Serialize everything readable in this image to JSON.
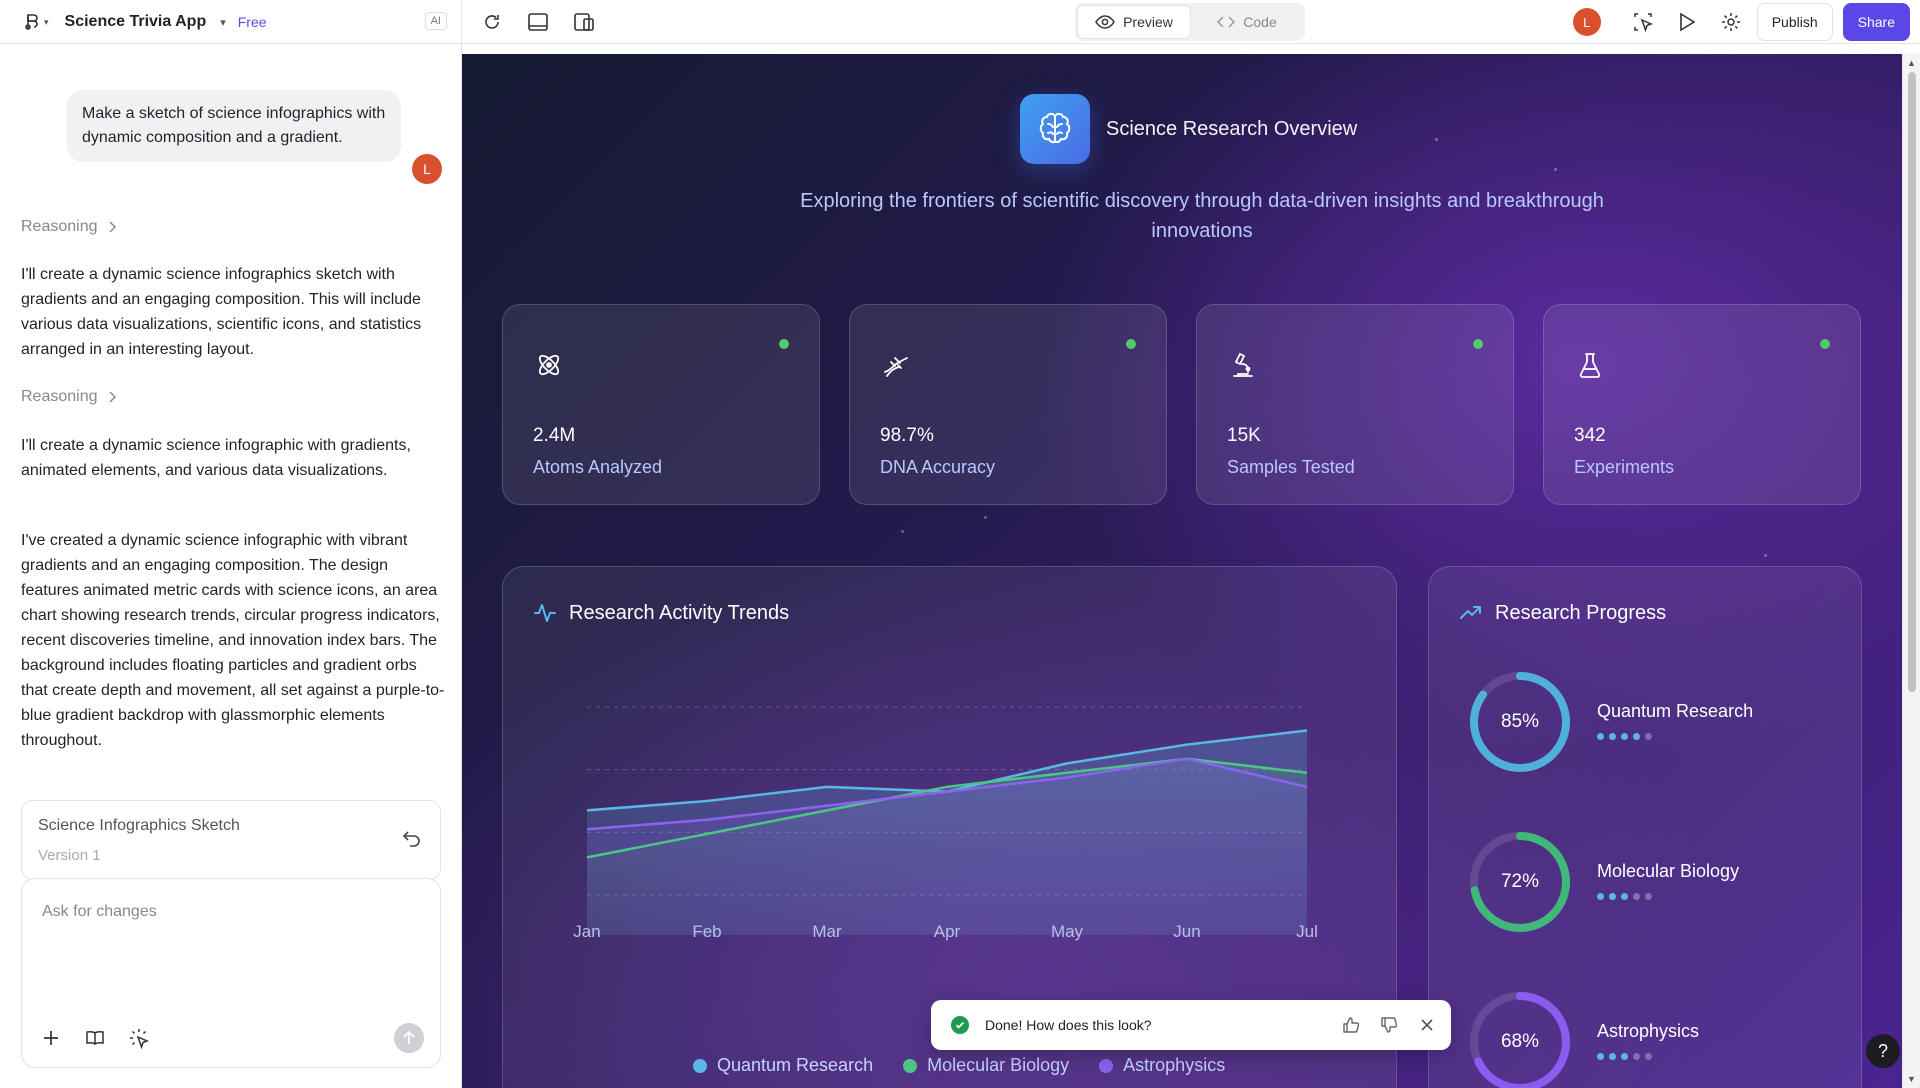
{
  "app": {
    "title": "Science Trivia App",
    "plan": "Free",
    "ai_badge": "AI"
  },
  "toolbar": {
    "preview_label": "Preview",
    "code_label": "Code",
    "avatar_initial": "L",
    "publish_label": "Publish",
    "share_label": "Share"
  },
  "chat": {
    "user_message": "Make a sketch of science infographics with dynamic composition and a gradient.",
    "user_avatar": "L",
    "reasoning_label": "Reasoning",
    "paragraph_1": "I'll create a dynamic science infographics sketch with gradients and an engaging composition. This will include various data visualizations, scientific icons, and statistics arranged in an interesting layout.",
    "paragraph_2": "I'll create a dynamic science infographic with gradients, animated elements, and various data visualizations.",
    "paragraph_3": "I've created a dynamic science infographic with vibrant gradients and an engaging composition. The design features animated metric cards with science icons, an area chart showing research trends, circular progress indicators, recent discoveries timeline, and innovation index bars. The background includes floating particles and gradient orbs that create depth and movement, all set against a purple-to-blue gradient backdrop with glassmorphic elements throughout.",
    "version_card": {
      "title": "Science Infographics Sketch",
      "subtitle": "Version 1"
    },
    "composer_placeholder": "Ask for changes"
  },
  "preview": {
    "hero_title": "Science Research Overview",
    "hero_subtitle": "Exploring the frontiers of scientific discovery through data-driven insights and breakthrough innovations",
    "metrics": [
      {
        "value": "2.4M",
        "label": "Atoms Analyzed",
        "icon": "atom-icon"
      },
      {
        "value": "98.7%",
        "label": "DNA Accuracy",
        "icon": "dna-icon"
      },
      {
        "value": "15K",
        "label": "Samples Tested",
        "icon": "microscope-icon"
      },
      {
        "value": "342",
        "label": "Experiments",
        "icon": "flask-icon"
      }
    ],
    "trends_title": "Research Activity Trends",
    "progress_title": "Research Progress",
    "progress": [
      {
        "name": "Quantum Research",
        "value": 85,
        "label": "85%",
        "color": "#4fb0d8",
        "dots_on": 4
      },
      {
        "name": "Molecular Biology",
        "value": 72,
        "label": "72%",
        "color": "#3fb87a",
        "dots_on": 3
      },
      {
        "name": "Astrophysics",
        "value": 68,
        "label": "68%",
        "color": "#8a5cf0",
        "dots_on": 3
      }
    ]
  },
  "chart_data": {
    "type": "area",
    "categories": [
      "Jan",
      "Feb",
      "Mar",
      "Apr",
      "May",
      "Jun",
      "Jul"
    ],
    "series": [
      {
        "name": "Quantum Research",
        "color": "#5ab8e6",
        "values": [
          68,
          70,
          73,
          72,
          78,
          82,
          85
        ]
      },
      {
        "name": "Molecular Biology",
        "color": "#4cc585",
        "values": [
          58,
          63,
          68,
          73,
          76,
          79,
          76
        ]
      },
      {
        "name": "Astrophysics",
        "color": "#8c63f0",
        "values": [
          64,
          66,
          69,
          72,
          75,
          79,
          73
        ]
      }
    ],
    "ylim": [
      0,
      100
    ],
    "grid": true,
    "legend": "bottom"
  },
  "toast": {
    "message": "Done! How does this look?"
  }
}
